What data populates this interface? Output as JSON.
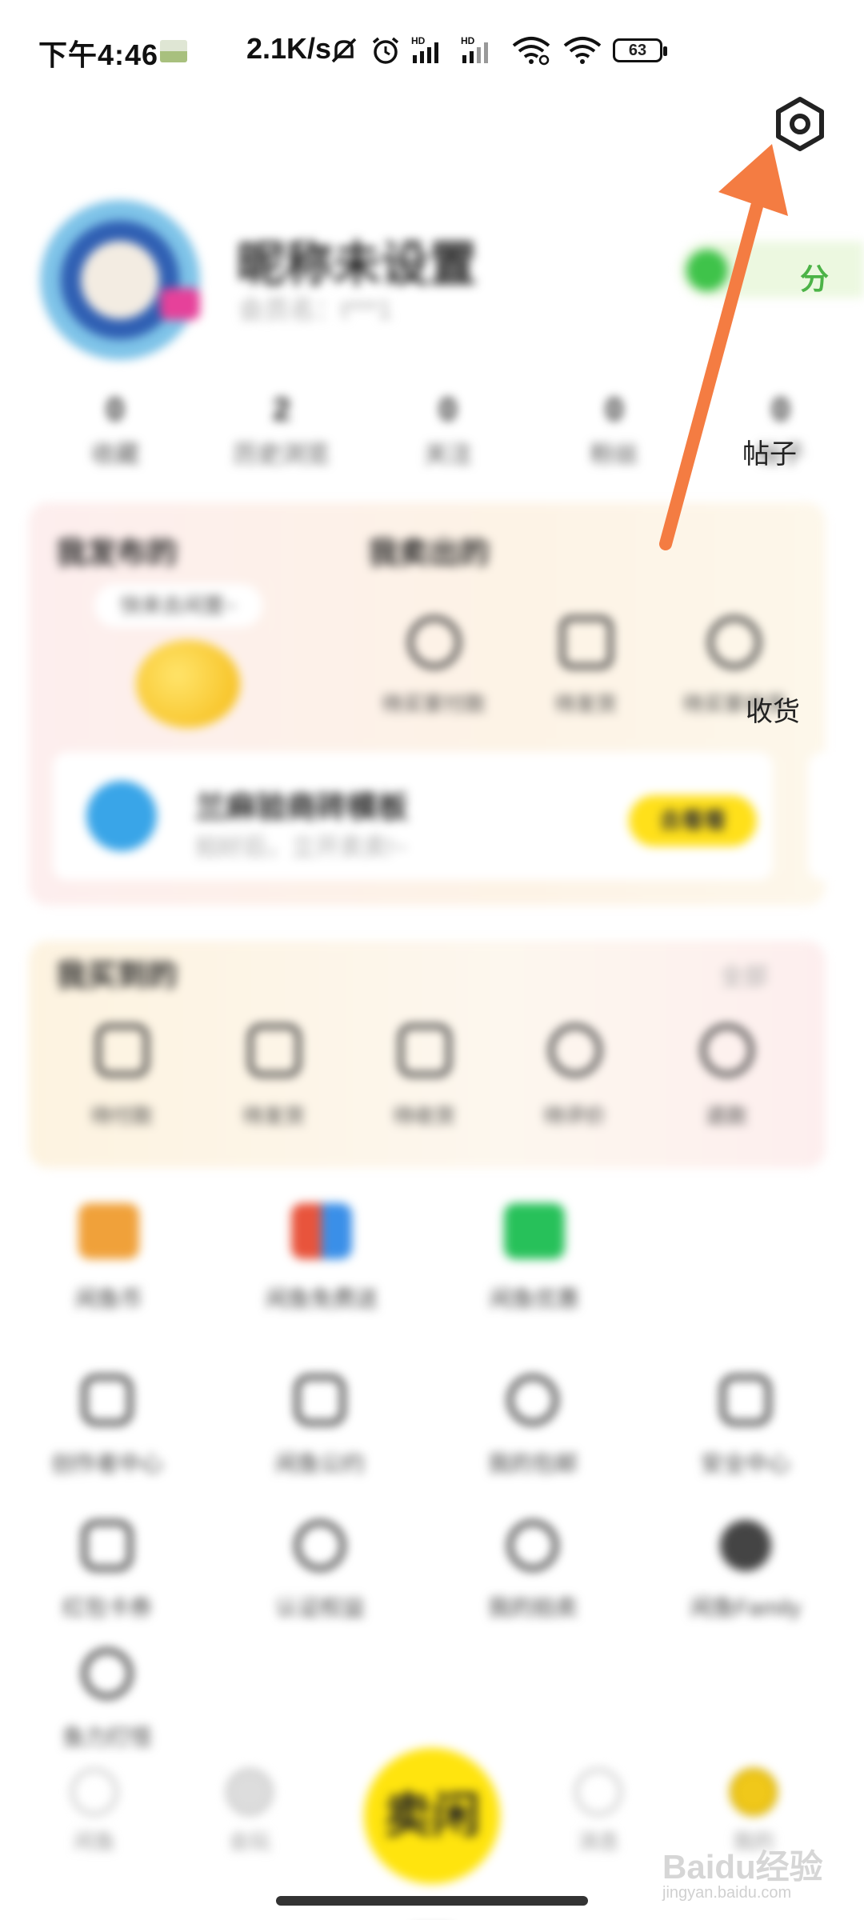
{
  "status_bar": {
    "time": "下午4:46",
    "speed": "2.1K/s",
    "battery": "63"
  },
  "profile": {
    "nickname": "昵称未设置",
    "user_id": "会员名：t***1",
    "points_label": "分"
  },
  "stats": [
    {
      "num": "0",
      "label": "收藏"
    },
    {
      "num": "2",
      "label": "历史浏览"
    },
    {
      "num": "0",
      "label": "关注"
    },
    {
      "num": "0",
      "label": "粉丝"
    },
    {
      "num": "0",
      "label": "帖子"
    }
  ],
  "sell_card": {
    "left_title": "我发布的",
    "bubble": "快来去闲置~",
    "right_title": "我卖出的",
    "actions": [
      {
        "label": "待买家付款",
        "icon": "yuan-icon"
      },
      {
        "label": "待发货",
        "icon": "megaphone-icon"
      },
      {
        "label": "待买家收货",
        "icon": "check-circle-icon"
      }
    ],
    "banner": {
      "title": "兰麻验商砖模板",
      "subtitle": "拍好后，立开卖卖!~",
      "button": "去看看"
    }
  },
  "buy_card": {
    "title": "我买到的",
    "more": "全部",
    "actions": [
      {
        "label": "待付款",
        "icon": "wallet-icon"
      },
      {
        "label": "待发货",
        "icon": "box-icon"
      },
      {
        "label": "待收货",
        "icon": "truck-icon"
      },
      {
        "label": "待评价",
        "icon": "comment-icon"
      },
      {
        "label": "退款",
        "icon": "refund-icon"
      }
    ]
  },
  "featured": [
    {
      "label": "闲鱼币",
      "color": "#f0a13a"
    },
    {
      "label": "闲鱼免费送",
      "color": "#e8543c"
    },
    {
      "label": "闲鱼优惠",
      "color": "#27c15a"
    }
  ],
  "services": [
    {
      "label": "创作者中心",
      "icon": "shield-icon"
    },
    {
      "label": "闲鱼公约",
      "icon": "book-icon"
    },
    {
      "label": "我的包邮",
      "icon": "gift-icon"
    },
    {
      "label": "安全中心",
      "icon": "security-icon"
    },
    {
      "label": "红包卡券",
      "icon": "coupon-icon"
    },
    {
      "label": "认证权益",
      "icon": "badge-icon"
    },
    {
      "label": "我的拍卖",
      "icon": "hammer-icon"
    },
    {
      "label": "闲鱼Family",
      "icon": "globe-icon"
    },
    {
      "label": "鱼力打怪",
      "icon": "game-icon"
    }
  ],
  "bottom_nav": [
    {
      "label": "闲鱼"
    },
    {
      "label": "会玩"
    },
    {
      "label": "卖闲置"
    },
    {
      "label": "消息"
    },
    {
      "label": "我的"
    }
  ],
  "sharp_text": {
    "posts_fragment": "帖子",
    "receive_fragment": "收货",
    "points_fragment": "分"
  },
  "watermark": {
    "brand": "Baidu经验",
    "url": "jingyan.baidu.com"
  },
  "colors": {
    "annotation_arrow": "#f47c42",
    "fab": "#ffe40e",
    "points_green": "#4cb347"
  }
}
